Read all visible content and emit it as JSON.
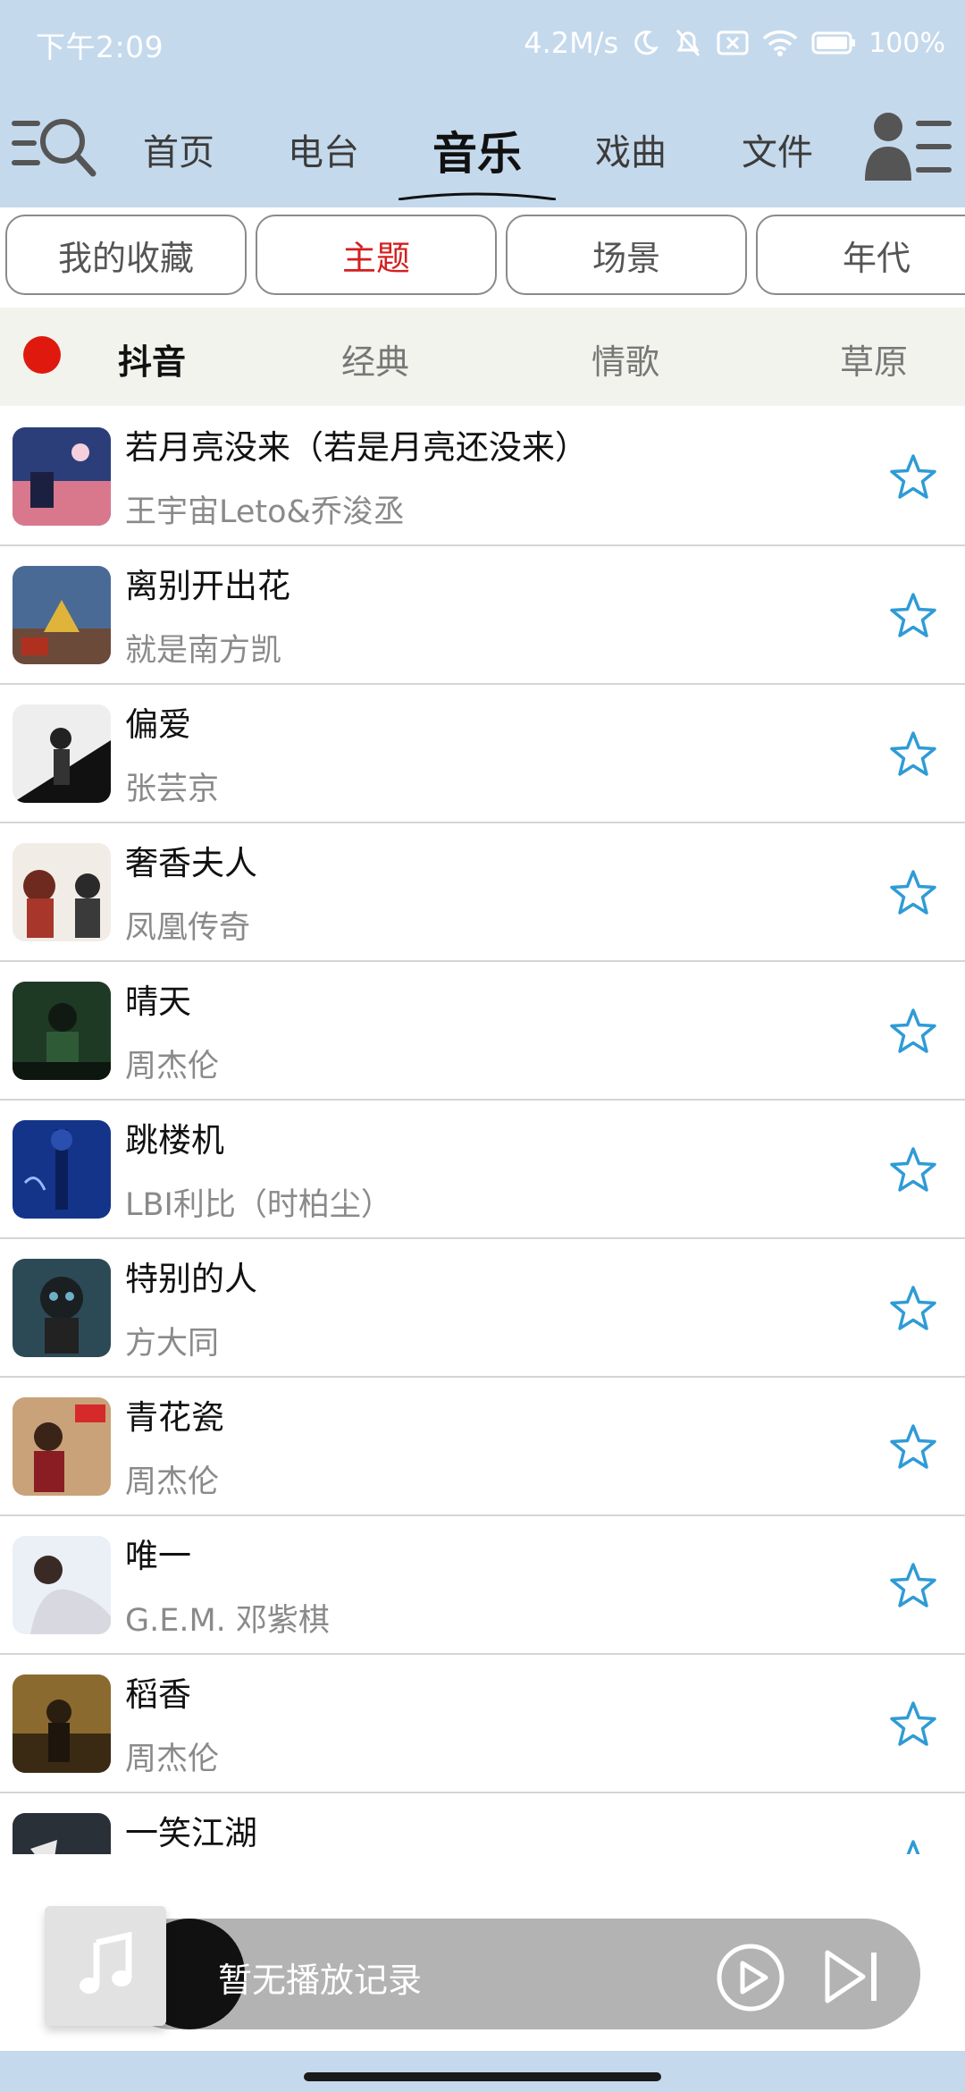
{
  "status_bar": {
    "time": "下午2:09",
    "speed": "4.2M/s",
    "battery": "100%",
    "icons": [
      "moon-icon",
      "mute-bell-icon",
      "sim-off-icon",
      "wifi-icon",
      "battery-icon"
    ]
  },
  "nav": {
    "tabs": [
      {
        "label": "首页"
      },
      {
        "label": "电台"
      },
      {
        "label": "音乐"
      },
      {
        "label": "戏曲"
      },
      {
        "label": "文件"
      }
    ],
    "active": "音乐"
  },
  "sub_tabs": {
    "items": [
      {
        "label": "我的收藏"
      },
      {
        "label": "主题"
      },
      {
        "label": "场景"
      },
      {
        "label": "年代"
      }
    ],
    "active": "主题",
    "active_color": "#d31f1f"
  },
  "genres": {
    "items": [
      {
        "label": "抖音"
      },
      {
        "label": "经典"
      },
      {
        "label": "情歌"
      },
      {
        "label": "草原"
      }
    ],
    "active": "抖音",
    "indicator_color": "#e0190f"
  },
  "songs": [
    {
      "title": "若月亮没来（若是月亮还没来）",
      "artist": "王宇宙Leto&乔浚丞"
    },
    {
      "title": "离别开出花",
      "artist": "就是南方凯"
    },
    {
      "title": "偏爱",
      "artist": "张芸京"
    },
    {
      "title": "奢香夫人",
      "artist": "凤凰传奇"
    },
    {
      "title": "晴天",
      "artist": "周杰伦"
    },
    {
      "title": "跳楼机",
      "artist": "LBI利比（时柏尘）"
    },
    {
      "title": "特别的人",
      "artist": "方大同"
    },
    {
      "title": "青花瓷",
      "artist": "周杰伦"
    },
    {
      "title": "唯一",
      "artist": "G.E.M. 邓紫棋"
    },
    {
      "title": "稻香",
      "artist": "周杰伦"
    },
    {
      "title": "一笑江湖",
      "artist": ""
    }
  ],
  "player": {
    "status_text": "暂无播放记录"
  },
  "colors": {
    "header_bg": "#c5d9ec",
    "star": "#2f9bd6"
  }
}
